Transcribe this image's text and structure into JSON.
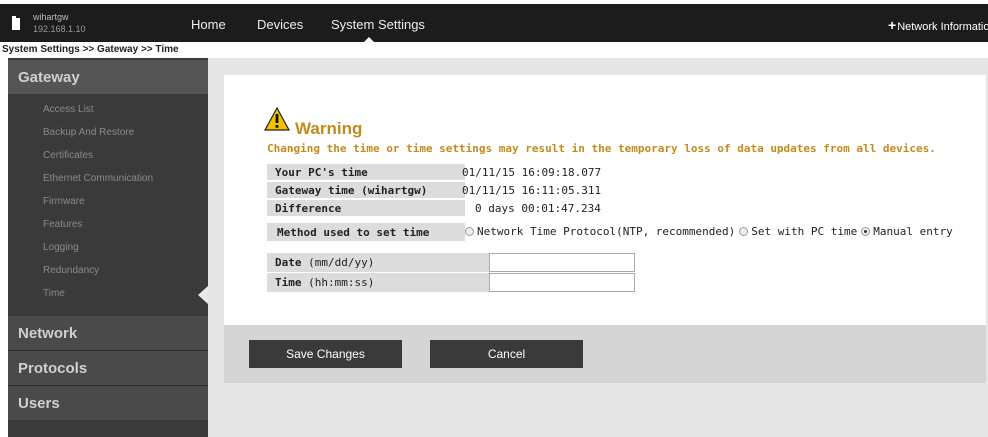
{
  "gateway": {
    "name": "wihartgw",
    "ip": "192.168.1.10"
  },
  "topnav": {
    "home": "Home",
    "devices": "Devices",
    "system_settings": "System Settings",
    "network_info": "Network Information"
  },
  "breadcrumb": "System Settings >> Gateway >> Time",
  "sidebar": {
    "sections": {
      "gateway": "Gateway",
      "network": "Network",
      "protocols": "Protocols",
      "users": "Users"
    },
    "gateway_items": [
      "Access List",
      "Backup And Restore",
      "Certificates",
      "Ethernet Communication",
      "Firmware",
      "Features",
      "Logging",
      "Redundancy",
      "Time"
    ],
    "selected_item": "Time"
  },
  "warning": {
    "title": "Warning",
    "message": "Changing the time or time settings may result in the temporary loss of data updates from all devices."
  },
  "time_table": {
    "pc_time_label": "Your PC's time",
    "pc_time_value": "01/11/15 16:09:18.077",
    "gateway_time_label": "Gateway time (wihartgw)",
    "gateway_time_value": "01/11/15 16:11:05.311",
    "difference_label": "Difference",
    "difference_value": "0 days 00:01:47.234"
  },
  "method": {
    "label": "Method used to set time",
    "options": [
      "Network Time Protocol(NTP, recommended)",
      "Set with PC time",
      "Manual entry"
    ],
    "selected": "Manual entry"
  },
  "form": {
    "date_label": "Date",
    "date_format": "(mm/dd/yy)",
    "date_value": "",
    "time_label": "Time",
    "time_format": "(hh:mm:ss)",
    "time_value": ""
  },
  "buttons": {
    "save": "Save Changes",
    "cancel": "Cancel"
  },
  "colors": {
    "warning": "#c58a1c",
    "topbar": "#1c1c1c",
    "sidebar": "#3a3a3a"
  }
}
